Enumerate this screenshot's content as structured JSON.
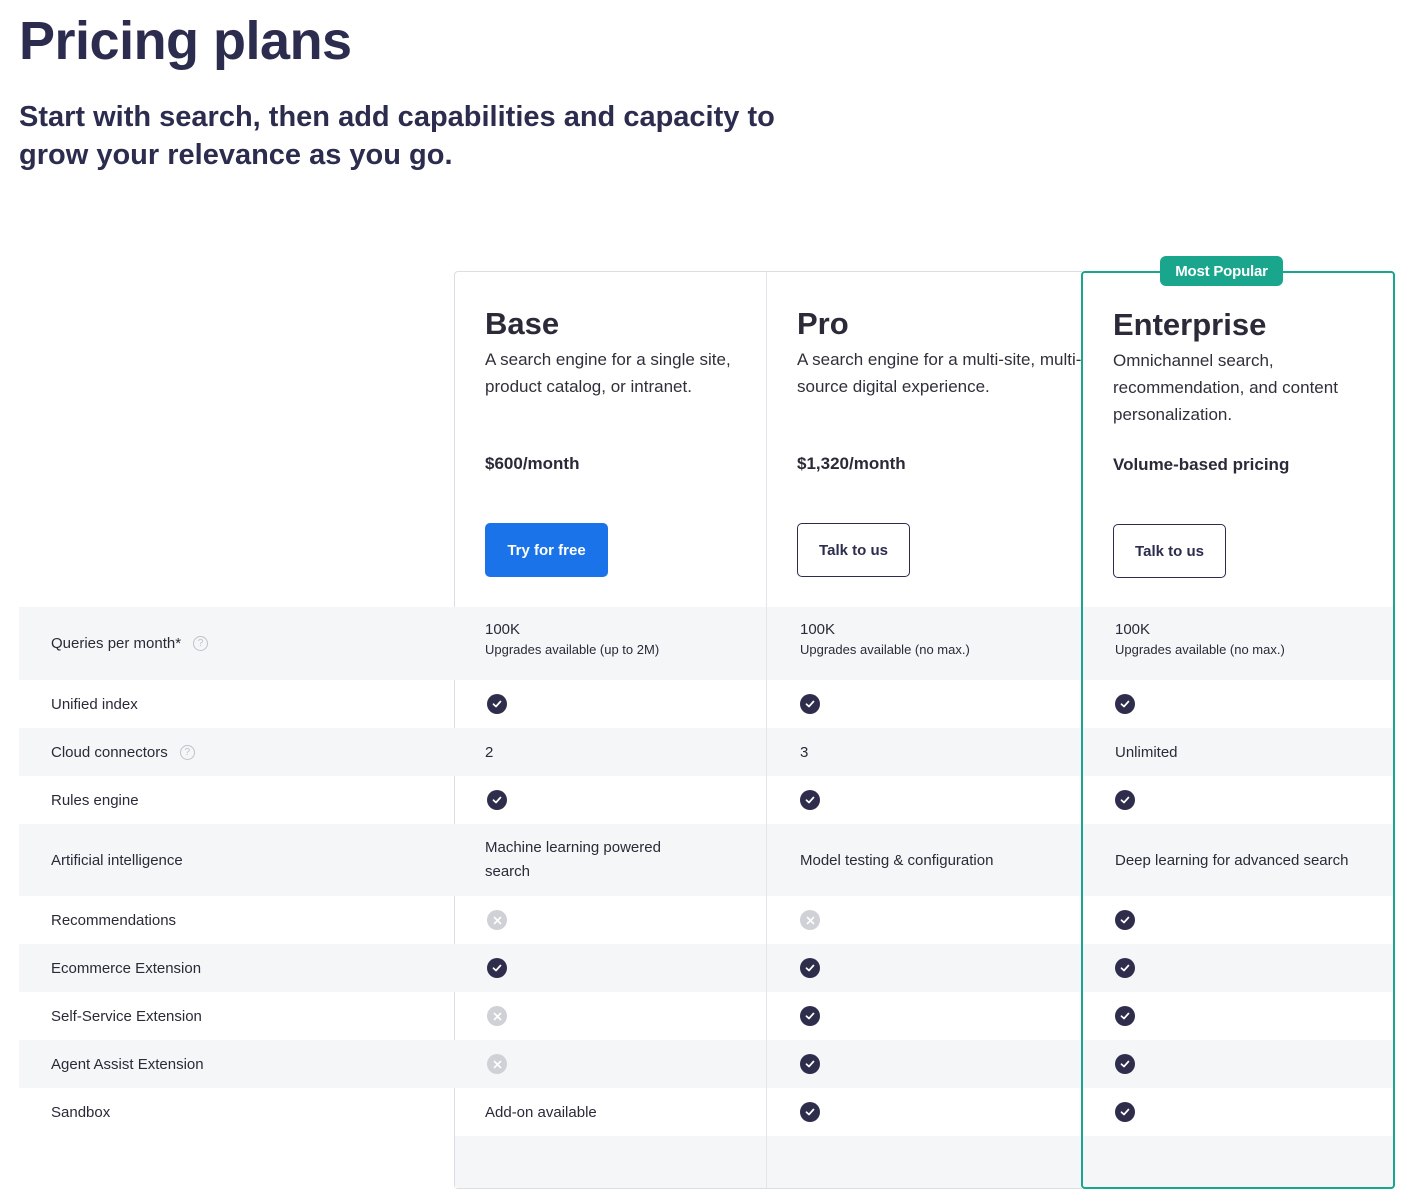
{
  "header": {
    "title": "Pricing plans",
    "subtitle": "Start with search, then add capabilities and capacity to grow your relevance as you go."
  },
  "badge": "Most Popular",
  "plans": [
    {
      "name": "Base",
      "description": "A search engine for a single site, product catalog, or intranet.",
      "price": "$600/month",
      "cta": "Try for free"
    },
    {
      "name": "Pro",
      "description": "A search engine for a multi-site, multi-source digital experience.",
      "price": "$1,320/month",
      "cta": "Talk to us"
    },
    {
      "name": "Enterprise",
      "description": "Omnichannel search, recommendation, and content personalization.",
      "price": "Volume-based pricing",
      "cta": "Talk to us"
    }
  ],
  "features": [
    {
      "label": "Queries per month*",
      "help": true,
      "values": [
        {
          "type": "text",
          "text": "100K",
          "sub": "Upgrades available (up to 2M)"
        },
        {
          "type": "text",
          "text": "100K",
          "sub": "Upgrades available (no max.)"
        },
        {
          "type": "text",
          "text": "100K",
          "sub": "Upgrades available (no max.)"
        }
      ]
    },
    {
      "label": "Unified index",
      "help": false,
      "values": [
        {
          "type": "check"
        },
        {
          "type": "check"
        },
        {
          "type": "check"
        }
      ]
    },
    {
      "label": "Cloud connectors",
      "help": true,
      "values": [
        {
          "type": "text",
          "text": "2"
        },
        {
          "type": "text",
          "text": "3"
        },
        {
          "type": "text",
          "text": "Unlimited"
        }
      ]
    },
    {
      "label": "Rules engine",
      "help": false,
      "values": [
        {
          "type": "check"
        },
        {
          "type": "check"
        },
        {
          "type": "check"
        }
      ]
    },
    {
      "label": "Artificial intelligence",
      "help": false,
      "values": [
        {
          "type": "text",
          "text": "Machine learning powered search"
        },
        {
          "type": "text",
          "text": "Model testing & configuration"
        },
        {
          "type": "text",
          "text": "Deep learning for advanced search"
        }
      ]
    },
    {
      "label": "Recommendations",
      "help": false,
      "values": [
        {
          "type": "cross"
        },
        {
          "type": "cross"
        },
        {
          "type": "check"
        }
      ]
    },
    {
      "label": "Ecommerce Extension",
      "help": false,
      "values": [
        {
          "type": "check"
        },
        {
          "type": "check"
        },
        {
          "type": "check"
        }
      ]
    },
    {
      "label": "Self-Service Extension",
      "help": false,
      "values": [
        {
          "type": "cross"
        },
        {
          "type": "check"
        },
        {
          "type": "check"
        }
      ]
    },
    {
      "label": "Agent Assist Extension",
      "help": false,
      "values": [
        {
          "type": "cross"
        },
        {
          "type": "check"
        },
        {
          "type": "check"
        }
      ]
    },
    {
      "label": "Sandbox",
      "help": false,
      "values": [
        {
          "type": "text",
          "text": "Add-on available"
        },
        {
          "type": "check"
        },
        {
          "type": "check"
        }
      ]
    }
  ]
}
